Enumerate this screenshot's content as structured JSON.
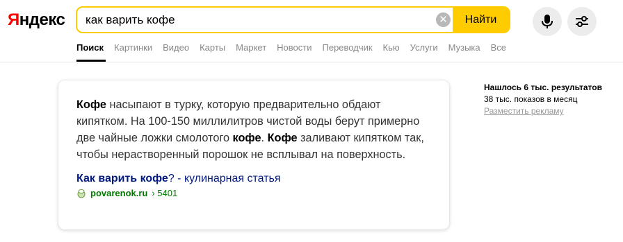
{
  "logo": {
    "first_letter": "Я",
    "rest": "ндекс"
  },
  "search": {
    "value": "как варить кофе",
    "clear_glyph": "✕",
    "submit_label": "Найти"
  },
  "tabs": [
    {
      "label": "Поиск"
    },
    {
      "label": "Картинки"
    },
    {
      "label": "Видео"
    },
    {
      "label": "Карты"
    },
    {
      "label": "Маркет"
    },
    {
      "label": "Новости"
    },
    {
      "label": "Переводчик"
    },
    {
      "label": "Кью"
    },
    {
      "label": "Услуги"
    },
    {
      "label": "Музыка"
    },
    {
      "label": "Все"
    }
  ],
  "answer": {
    "p1_bold": "Кофе",
    "p1": " насыпают в турку, которую предварительно обдают кипятком. На 100-150 миллилитров чистой воды берут примерно две чайные ложки смолотого ",
    "p2_bold": "кофе",
    "p2": ". ",
    "p3_bold": "Кофе",
    "p3": " заливают кипятком так, чтобы нерастворенный порошок не всплывал на поверхность.",
    "title_bold": "Как варить кофе",
    "title_rest": "? - кулинарная статья",
    "source_domain": "povarenok.ru",
    "source_path": " › 5401"
  },
  "side": {
    "found": "Нашлось 6 тыс. результатов",
    "shows": "38 тыс. показов в месяц",
    "ad_link": "Разместить рекламу"
  },
  "colors": {
    "accent": "#ffcc00",
    "logo_red": "#ff0000",
    "link": "#001a80",
    "source_green": "#007700"
  }
}
